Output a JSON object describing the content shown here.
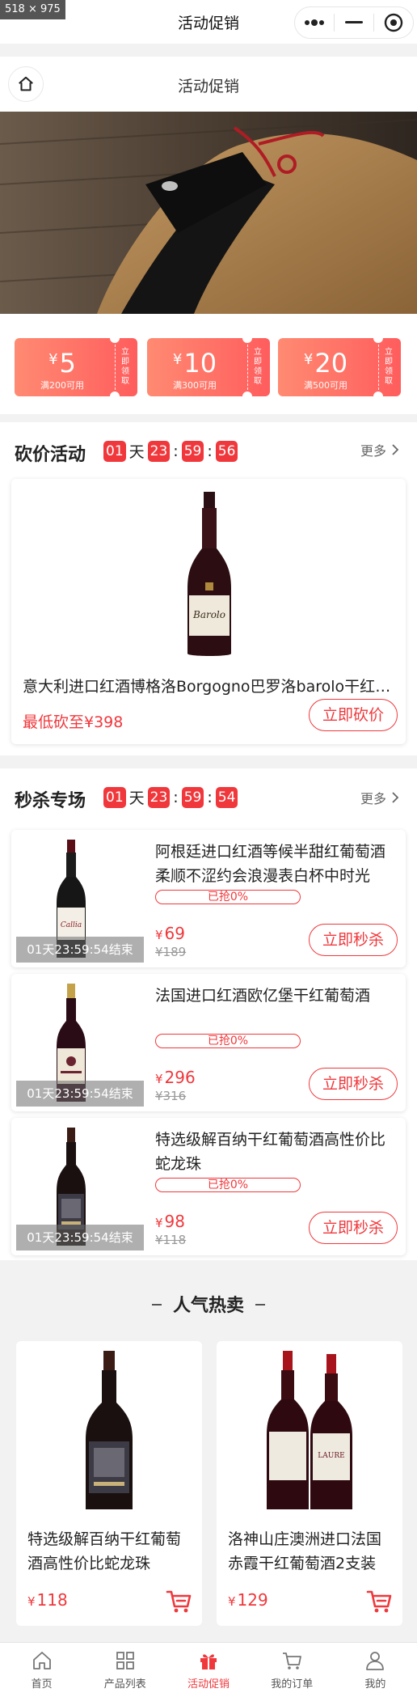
{
  "screen": {
    "size_label": "518 × 975"
  },
  "window": {
    "title": "活动促销"
  },
  "capsule": {
    "icons": [
      "more-dots-icon",
      "minimize-icon",
      "target-icon"
    ]
  },
  "nav": {
    "title": "活动促销",
    "home_icon": "home-icon"
  },
  "coupons": [
    {
      "symbol": "¥",
      "amount": "5",
      "condition": "满200可用",
      "action": "立即领取"
    },
    {
      "symbol": "¥",
      "amount": "10",
      "condition": "满300可用",
      "action": "立即领取"
    },
    {
      "symbol": "¥",
      "amount": "20",
      "condition": "满500可用",
      "action": "立即领取"
    }
  ],
  "bargain": {
    "title": "砍价活动",
    "countdown": {
      "days": "01",
      "day_unit": "天",
      "hours": "23",
      "minutes": "59",
      "seconds": "56"
    },
    "more": "更多",
    "product": {
      "name": "意大利进口红酒博格洛Borgogno巴罗洛barolo干红葡萄酒",
      "price_label": "最低砍至¥398",
      "button": "立即砍价"
    }
  },
  "seckill": {
    "title": "秒杀专场",
    "countdown": {
      "days": "01",
      "day_unit": "天",
      "hours": "23",
      "minutes": "59",
      "seconds": "54"
    },
    "more": "更多",
    "items": [
      {
        "name": "阿根廷进口红酒等候半甜红葡萄酒柔顺不涩约会浪漫表白杯中时光",
        "progress": "已抢0%",
        "price_symbol": "¥",
        "price": "69",
        "original": "¥189",
        "ends": "01天23:59:54结束",
        "button": "立即秒杀"
      },
      {
        "name": "法国进口红酒欧亿堡干红葡萄酒",
        "progress": "已抢0%",
        "price_symbol": "¥",
        "price": "296",
        "original": "¥316",
        "ends": "01天23:59:54结束",
        "button": "立即秒杀"
      },
      {
        "name": "特选级解百纳干红葡萄酒高性价比蛇龙珠",
        "progress": "已抢0%",
        "price_symbol": "¥",
        "price": "98",
        "original": "¥118",
        "ends": "01天23:59:54结束",
        "button": "立即秒杀"
      }
    ]
  },
  "popular": {
    "title": "人气热卖",
    "items": [
      {
        "name": "特选级解百纳干红葡萄酒高性价比蛇龙珠",
        "price_symbol": "¥",
        "price": "118"
      },
      {
        "name": "洛神山庄澳洲进口法国赤霞干红葡萄酒2支装",
        "price_symbol": "¥",
        "price": "129"
      }
    ]
  },
  "tabbar": {
    "items": [
      {
        "label": "首页",
        "icon": "home-icon"
      },
      {
        "label": "产品列表",
        "icon": "grid-icon"
      },
      {
        "label": "活动促销",
        "icon": "gift-icon",
        "active": true
      },
      {
        "label": "我的订单",
        "icon": "cart-icon"
      },
      {
        "label": "我的",
        "icon": "user-icon"
      }
    ]
  },
  "colors": {
    "accent": "#f0383c",
    "coupon_start": "#ff8a72",
    "coupon_end": "#ff5d5d",
    "background": "#f2f2f2"
  }
}
